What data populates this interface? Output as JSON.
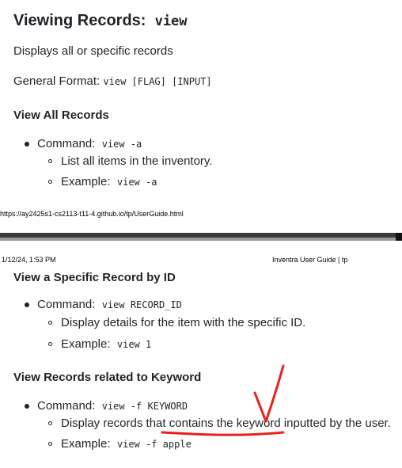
{
  "page1": {
    "title": "Viewing Records:",
    "title_code": "view",
    "description": "Displays all or specific records",
    "general_format_label": "General Format:",
    "general_format_code": "view [FLAG] [INPUT]",
    "section_heading": "View All Records",
    "command_label": "Command:",
    "command_code": "view -a",
    "detail": "List all items in the inventory.",
    "example_label": "Example:",
    "example_code": "view -a",
    "footer_url": "https://ay2425s1-cs2113-t11-4.github.io/tp/UserGuide.html"
  },
  "page2": {
    "header_date": "1/12/24, 1:53 PM",
    "header_title": "Inventra User Guide | tp",
    "section1": {
      "heading": "View a Specific Record by ID",
      "command_label": "Command:",
      "command_code": "view RECORD_ID",
      "detail": "Display details for the item with the specific ID.",
      "example_label": "Example:",
      "example_code": "view 1"
    },
    "section2": {
      "heading": "View Records related to Keyword",
      "command_label": "Command:",
      "command_code": "view -f KEYWORD",
      "detail": "Display records that contains the keyword inputted by the user.",
      "example_label": "Example:",
      "example_code": "view -f apple"
    }
  },
  "annotation": {
    "color": "#e8201f"
  }
}
